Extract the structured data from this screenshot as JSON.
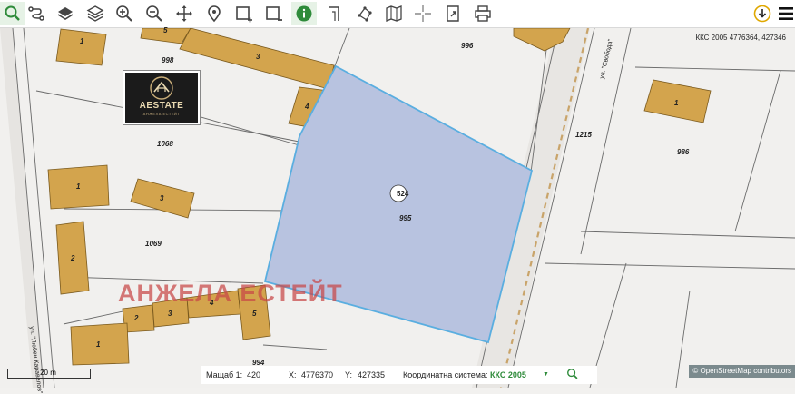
{
  "toolbar": {
    "left_tools": [
      {
        "name": "search-zoom",
        "icon": "search-icon"
      },
      {
        "name": "route",
        "icon": "route-icon"
      },
      {
        "name": "layers",
        "icon": "layers-icon"
      },
      {
        "name": "layers-stack",
        "icon": "stack-icon"
      },
      {
        "name": "zoom-in",
        "icon": "zoom-in-icon"
      },
      {
        "name": "zoom-out",
        "icon": "zoom-out-icon"
      },
      {
        "name": "pan",
        "icon": "move-icon"
      },
      {
        "name": "marker",
        "icon": "pin-icon"
      },
      {
        "name": "select-rect",
        "icon": "select-rect-icon"
      },
      {
        "name": "select-rect-minus",
        "icon": "select-rect-minus-icon"
      },
      {
        "name": "info",
        "icon": "info-icon"
      },
      {
        "name": "measure-line",
        "icon": "measure-line-icon"
      },
      {
        "name": "measure-polygon",
        "icon": "measure-polygon-icon"
      },
      {
        "name": "map",
        "icon": "map-icon"
      },
      {
        "name": "crosshair",
        "icon": "crosshair-icon"
      },
      {
        "name": "export",
        "icon": "export-icon"
      },
      {
        "name": "print",
        "icon": "print-icon"
      }
    ],
    "right_tools": [
      {
        "name": "download",
        "icon": "download-circle-icon"
      },
      {
        "name": "menu",
        "icon": "hamburger-icon"
      }
    ]
  },
  "map": {
    "crs_readout": "ККС 2005 4776364, 427346",
    "parcel_badge": "524",
    "labels": [
      {
        "id": "lbl-998",
        "text": "998"
      },
      {
        "id": "lbl-996",
        "text": "996"
      },
      {
        "id": "lbl-1068",
        "text": "1068"
      },
      {
        "id": "lbl-1069",
        "text": "1069"
      },
      {
        "id": "lbl-995",
        "text": "995"
      },
      {
        "id": "lbl-1215",
        "text": "1215"
      },
      {
        "id": "lbl-986",
        "text": "986"
      },
      {
        "id": "lbl-994",
        "text": "994"
      },
      {
        "id": "bld-1a",
        "text": "1"
      },
      {
        "id": "bld-5a",
        "text": "5"
      },
      {
        "id": "bld-3a",
        "text": "3"
      },
      {
        "id": "bld-4a",
        "text": "4"
      },
      {
        "id": "bld-1b",
        "text": "1"
      },
      {
        "id": "bld-3b",
        "text": "3"
      },
      {
        "id": "bld-2a",
        "text": "2"
      },
      {
        "id": "bld-2b",
        "text": "2"
      },
      {
        "id": "bld-3c",
        "text": "3"
      },
      {
        "id": "bld-4b",
        "text": "4"
      },
      {
        "id": "bld-5b",
        "text": "5"
      },
      {
        "id": "bld-1c",
        "text": "1"
      },
      {
        "id": "bld-1d",
        "text": "1"
      }
    ],
    "street_left": "ул. \"Любен Каравелов\"",
    "street_right": "ул. \"Свобода\"",
    "watermark": "АНЖЕЛА ЕСТЕЙТ",
    "logo": {
      "brand": "AESTATE",
      "sub": "АНЖЕЛА ЕСТЕЙТ"
    },
    "scalebar": "20 m",
    "attribution": "© OpenStreetMap contributors",
    "colors": {
      "parcel_fill": "#b8c3e0",
      "parcel_stroke": "#5aaee0",
      "building": "#d3a44d",
      "road": "#e8e6e3"
    }
  },
  "status": {
    "scale_label": "Мащаб 1:",
    "scale_value": "420",
    "x_label": "X:",
    "x_value": "4776370",
    "y_label": "Y:",
    "y_value": "427335",
    "crs_label": "Координатна система:",
    "crs_value": "ККС 2005"
  }
}
